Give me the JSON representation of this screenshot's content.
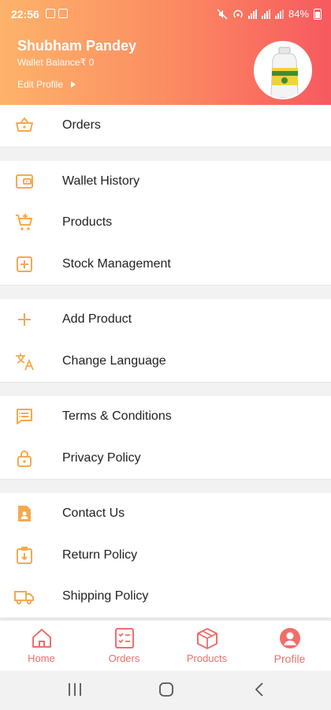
{
  "status_bar": {
    "time": "22:56",
    "battery": "84%"
  },
  "profile": {
    "name": "Shubham Pandey",
    "wallet_balance": "Wallet Balance₹ 0",
    "edit_label": "Edit Profile"
  },
  "menu": {
    "groups": [
      {
        "items": [
          {
            "label": "Orders",
            "icon": "basket-icon"
          }
        ]
      },
      {
        "items": [
          {
            "label": "Wallet History",
            "icon": "wallet-icon"
          },
          {
            "label": "Products",
            "icon": "cart-icon"
          },
          {
            "label": "Stock Management",
            "icon": "add-box-icon"
          }
        ]
      },
      {
        "items": [
          {
            "label": "Add Product",
            "icon": "plus-icon"
          },
          {
            "label": "Change Language",
            "icon": "translate-icon"
          }
        ]
      },
      {
        "items": [
          {
            "label": "Terms & Conditions",
            "icon": "document-icon"
          },
          {
            "label": "Privacy Policy",
            "icon": "lock-icon"
          }
        ]
      },
      {
        "items": [
          {
            "label": "Contact Us",
            "icon": "contact-icon"
          },
          {
            "label": "Return Policy",
            "icon": "return-icon"
          },
          {
            "label": "Shipping Policy",
            "icon": "truck-icon"
          }
        ]
      }
    ]
  },
  "bottom_nav": {
    "items": [
      {
        "label": "Home",
        "icon": "home-icon"
      },
      {
        "label": "Orders",
        "icon": "clipboard-icon"
      },
      {
        "label": "Products",
        "icon": "box-icon"
      },
      {
        "label": "Profile",
        "icon": "user-icon",
        "active": true
      }
    ]
  },
  "colors": {
    "accent": "#f5a94e",
    "nav": "#f26d6a",
    "header_start": "#fdb36a",
    "header_end": "#f7595f"
  }
}
